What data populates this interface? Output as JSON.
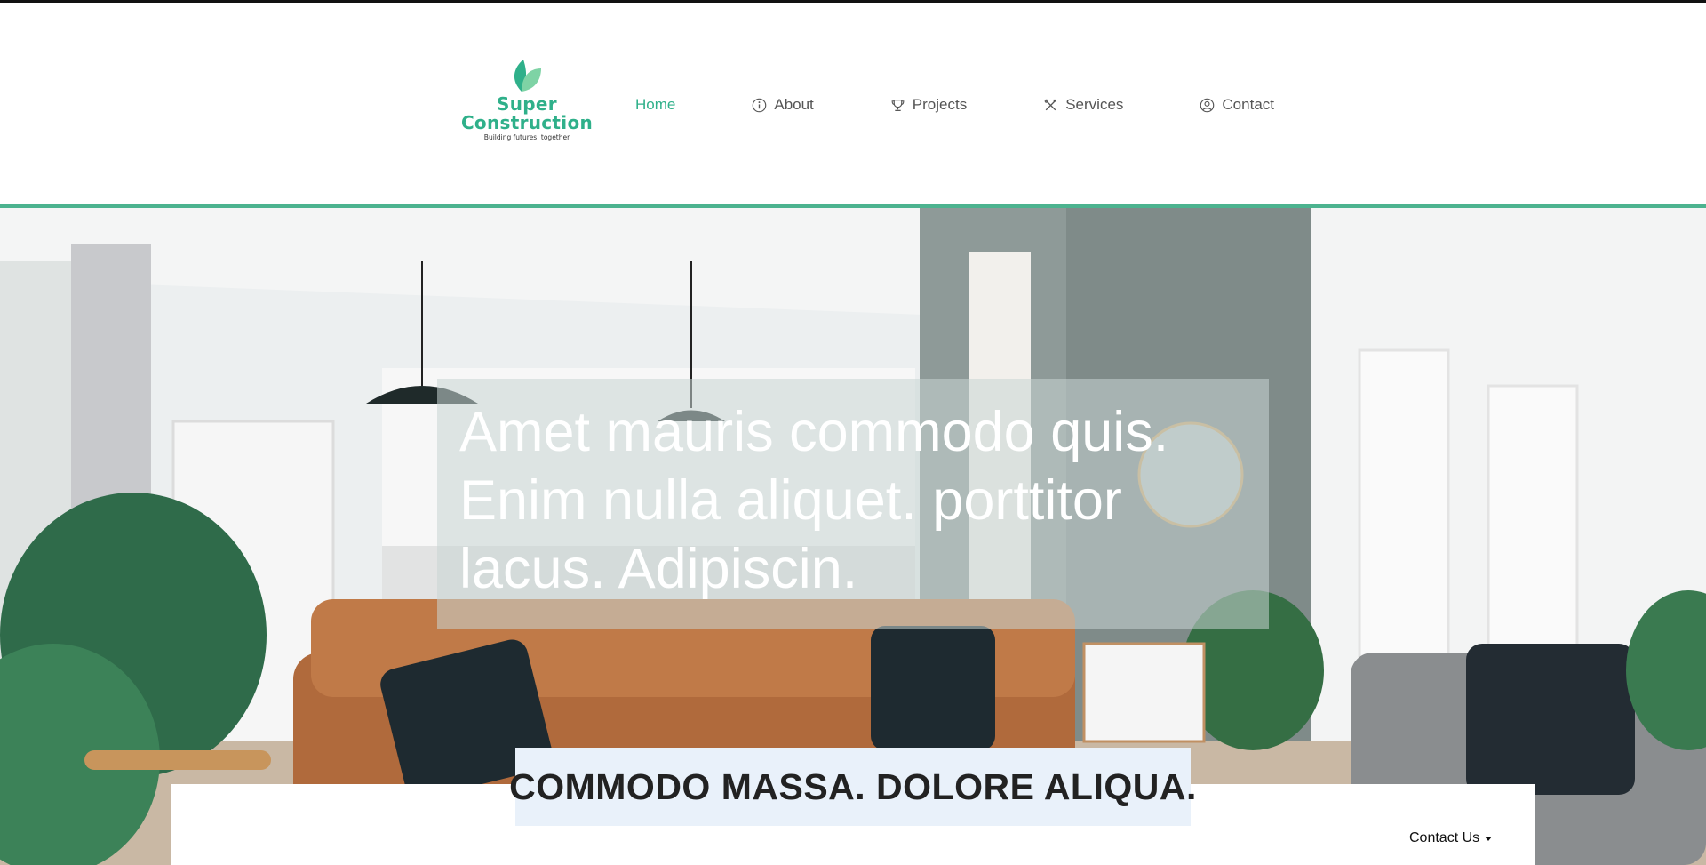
{
  "brand": {
    "name_line1": "Super",
    "name_line2": "Construction",
    "tagline": "Building futures, together",
    "color": "#2fb08a"
  },
  "nav": {
    "items": [
      {
        "label": "Home",
        "icon": "none",
        "active": true
      },
      {
        "label": "About",
        "icon": "info-icon",
        "active": false
      },
      {
        "label": "Projects",
        "icon": "trophy-icon",
        "active": false
      },
      {
        "label": "Services",
        "icon": "tools-icon",
        "active": false
      },
      {
        "label": "Contact",
        "icon": "user-circle-icon",
        "active": false
      }
    ]
  },
  "hero": {
    "headline": "Amet mauris commodo quis. Enim nulla aliquet. porttitor lacus. Adipiscin.",
    "subheadline": "COMMODO MASSA. DOLORE ALIQUA."
  },
  "contact_dropdown": {
    "label": "Contact Us"
  },
  "colors": {
    "accent": "#4cb38f",
    "subhead_bg": "#e9f1fa"
  }
}
